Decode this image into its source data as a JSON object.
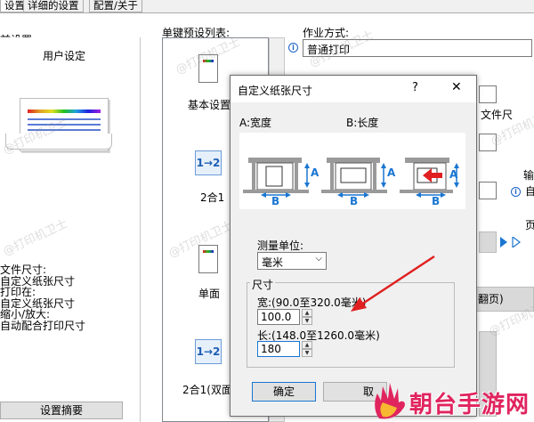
{
  "tabs": [
    {
      "label": "设置",
      "active": true
    },
    {
      "label": "详细的设置",
      "active": false
    },
    {
      "label": "配置/关于",
      "active": false
    }
  ],
  "left": {
    "current_settings_label": "前设置",
    "user_setting_label": "用户设定",
    "summary_lines": [
      "文件尺寸:",
      "自定义纸张尺寸",
      "打印在:",
      "自定义纸张尺寸",
      "缩小/放大:",
      "自动配合打印尺寸"
    ],
    "summary_button": "设置摘要"
  },
  "presets": {
    "label": "单键预设列表:",
    "items": [
      {
        "label": "基本设置",
        "icon": "document-icon"
      },
      {
        "label": "2合1",
        "icon": "two-in-one-icon",
        "glyph": "1→2"
      },
      {
        "label": "单面",
        "icon": "document-icon"
      },
      {
        "label": "2合1(双面",
        "icon": "two-in-one-icon",
        "glyph": "1→2"
      }
    ]
  },
  "right": {
    "job_mode_label": "作业方式:",
    "job_mode_value": "普通打印",
    "partial_label_1": "文件尺",
    "partial_label_2": "输",
    "partial_label_3": "自",
    "partial_label_4": "页",
    "partial_label_5": "翻页)"
  },
  "dialog": {
    "title": "自定义纸张尺寸",
    "help": "?",
    "close": "✕",
    "width_caption": "A:宽度",
    "length_caption": "B:长度",
    "unit_label": "测量单位:",
    "unit_value": "毫米",
    "size_group": "尺寸",
    "width_range": "宽:(90.0至320.0毫米)",
    "width_value": "100.0",
    "length_range": "长:(148.0至1260.0毫米)",
    "length_value": "180",
    "ok": "确定",
    "cancel_partial": "取",
    "dim_a": "A",
    "dim_b": "B"
  },
  "watermark": "@打印机卫士",
  "logo": {
    "text": "朝台手游网",
    "color": "#e0245e"
  },
  "colors": {
    "accent": "#1a76d2",
    "annotation_arrow": "#e02020"
  }
}
